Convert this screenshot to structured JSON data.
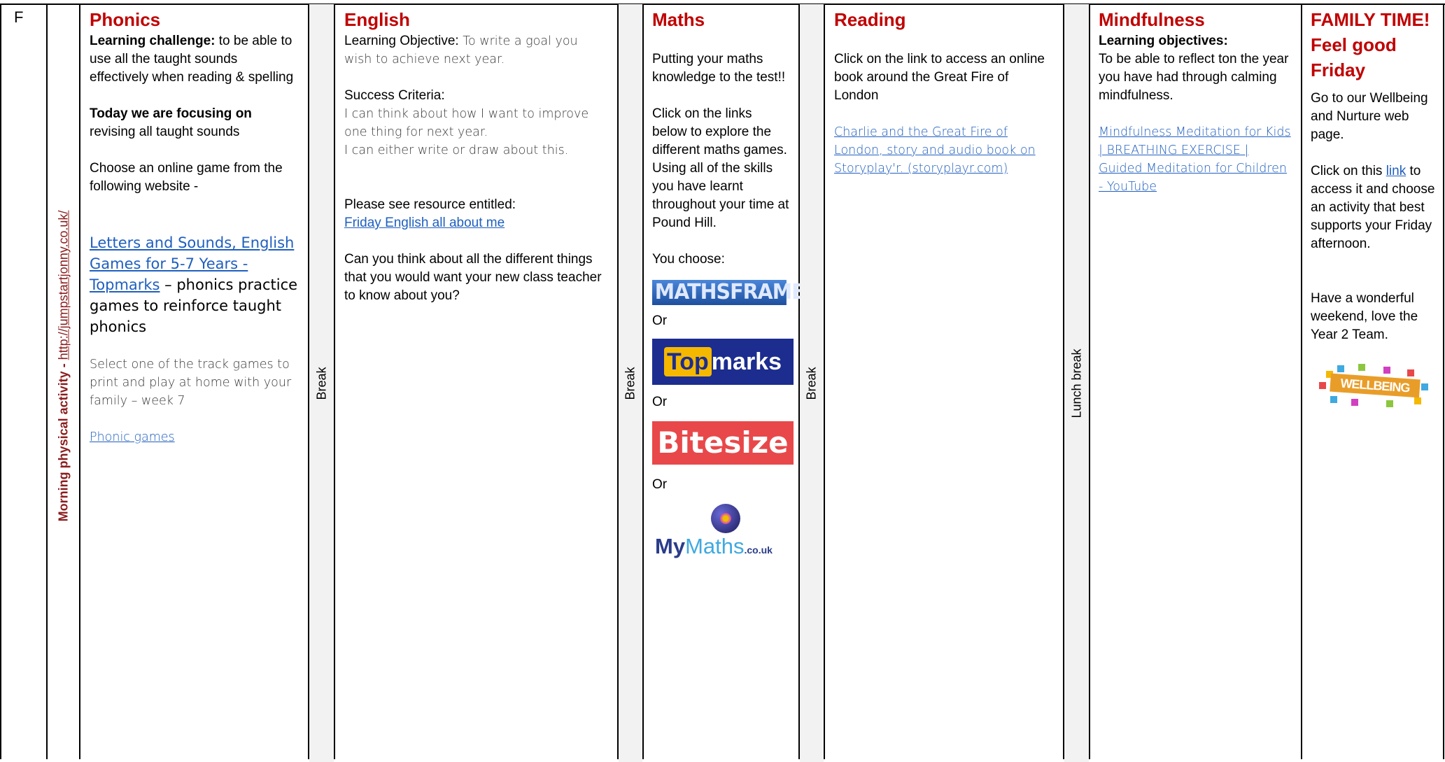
{
  "day_letter": "F",
  "morning": {
    "label": "Morning physical activity - ",
    "link": "http://jumpstartjonny.co.uk/"
  },
  "breaks": {
    "break1": "Break",
    "break2": "Break",
    "break3": "Break",
    "lunch": "Lunch break"
  },
  "phonics": {
    "title": "Phonics",
    "challenge_label": "Learning challenge:",
    "challenge_text": " to be able to use all the taught sounds effectively when reading & spelling",
    "focus_label": "Today we are focusing on",
    "focus_text": " revising all taught sounds",
    "choose_text": "Choose an online game from the following website -",
    "game_link": "Letters and Sounds, English Games for 5-7 Years - Topmarks",
    "game_desc": " – phonics practice games to reinforce taught phonics",
    "track_text": "Select one of the track games to print and play at home with your family – week 7",
    "phonic_link": "Phonic games"
  },
  "english": {
    "title": "English",
    "objective_label": "Learning Objective:",
    "objective_text": " To write a goal you wish to achieve next year.",
    "success_label": "Success Criteria:",
    "success_1": "I can think about how I want to improve one thing for next year.",
    "success_2": "I can either write or draw about this.",
    "resource_text": "Please see resource entitled:",
    "resource_link": "Friday English all about me",
    "question": "Can you think about all the different things that you would want your new class teacher to know about you?"
  },
  "maths": {
    "title": "Maths",
    "intro": "Putting your maths knowledge to the test!!",
    "instructions": "Click on the links below to explore the different maths games. Using all of the skills you have learnt throughout your time at Pound Hill.",
    "choose": "You choose:",
    "or_1": "Or",
    "or_2": "Or",
    "or_3": "Or",
    "logo_mathsframe": "MATHSFRAME",
    "logo_topmarks_a": "Top",
    "logo_topmarks_b": "marks",
    "logo_bitesize": "Bitesize",
    "logo_mymaths_a": "My",
    "logo_mymaths_b": "Maths",
    "logo_mymaths_c": ".co.uk"
  },
  "reading": {
    "title": "Reading",
    "text": "Click on the link to access an online book around the Great Fire of London",
    "link": "Charlie and the Great Fire of London, story and audio book on Storyplay'r. (storyplayr.com)"
  },
  "mindfulness": {
    "title": "Mindfulness",
    "objectives_label": "Learning objectives:",
    "objectives_text": "To be able to reflect ton the year you have had through calming mindfulness.",
    "link": "Mindfulness Meditation for Kids | BREATHING EXERCISE | Guided Meditation for Children - YouTube"
  },
  "family": {
    "title": "FAMILY TIME! Feel good Friday",
    "text_1": "Go to our Wellbeing and Nurture web page.",
    "click_a": "Click on this ",
    "click_link": "link",
    "click_b": " to access it and choose an activity that best supports your Friday afternoon.",
    "closing": "Have a wonderful weekend, love the Year 2 Team.",
    "logo_wellbeing": "WELLBEING"
  },
  "colors": {
    "heading_red": "#c00000",
    "link_blue": "#1f5fbf",
    "morning_red": "#8b1c1c"
  }
}
